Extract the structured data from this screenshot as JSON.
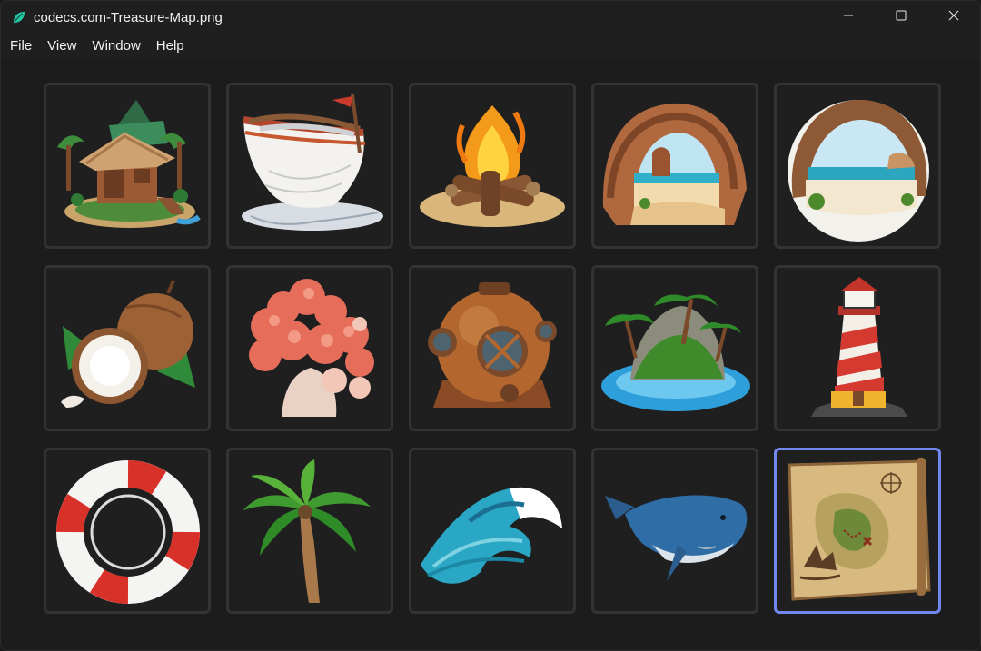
{
  "window": {
    "title": "codecs.com-Treasure-Map.png",
    "app_icon": "leaf-app-icon",
    "controls": [
      "minimize-icon",
      "maximize-icon",
      "close-icon"
    ]
  },
  "menu": {
    "items": [
      "File",
      "View",
      "Window",
      "Help"
    ]
  },
  "gallery": {
    "selected_index": 14,
    "selection_color": "#7288f0",
    "tiles": [
      {
        "icon": "tiki-hut-icon"
      },
      {
        "icon": "rowboat-icon"
      },
      {
        "icon": "campfire-icon"
      },
      {
        "icon": "sea-cave-icon"
      },
      {
        "icon": "beach-cave-icon"
      },
      {
        "icon": "coconut-icon"
      },
      {
        "icon": "coral-icon"
      },
      {
        "icon": "diving-helmet-icon"
      },
      {
        "icon": "palm-island-icon"
      },
      {
        "icon": "lighthouse-icon"
      },
      {
        "icon": "life-ring-icon"
      },
      {
        "icon": "palm-tree-icon"
      },
      {
        "icon": "wave-icon"
      },
      {
        "icon": "whale-icon"
      },
      {
        "icon": "treasure-map-icon"
      }
    ]
  }
}
